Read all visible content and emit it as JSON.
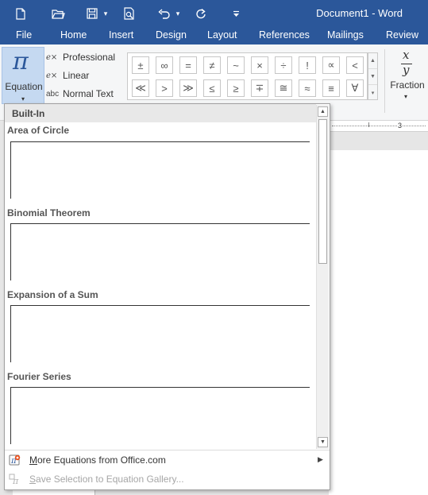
{
  "window": {
    "title": "Document1 - Word"
  },
  "quick_access": {
    "icons": [
      "new-document-icon",
      "open-folder-icon",
      "save-icon",
      "save-dropdown-icon",
      "print-preview-icon",
      "undo-icon",
      "undo-dropdown-icon",
      "redo-icon",
      "customize-toolbar-icon"
    ]
  },
  "tabs": [
    "File",
    "Home",
    "Insert",
    "Design",
    "Layout",
    "References",
    "Mailings",
    "Review"
  ],
  "ribbon": {
    "equation_label": "Equation",
    "equation_symbol": "π",
    "caret": "▾",
    "tools": {
      "professional": "Professional",
      "linear": "Linear",
      "normal_text": "Normal Text",
      "abc_icon": "abc",
      "ex_icon": "e×"
    },
    "symbols_row1": [
      "±",
      "∞",
      "=",
      "≠",
      "~",
      "×",
      "÷",
      "!",
      "∝",
      "<"
    ],
    "symbols_row2": [
      "≪",
      ">",
      "≫",
      "≤",
      "≥",
      "∓",
      "≅",
      "≈",
      "≡",
      "∀"
    ],
    "gallery_scroll": [
      "▲",
      "▼",
      "▾"
    ],
    "fraction": {
      "label": "Fraction",
      "numerator": "x",
      "denominator": "y"
    }
  },
  "ruler": {
    "number": "3"
  },
  "dropdown": {
    "header": "Built-In",
    "sections": [
      "Area of Circle",
      "Binomial Theorem",
      "Expansion of a Sum",
      "Fourier Series"
    ],
    "scroll_up": "▲",
    "scroll_down": "▼",
    "more_equations": {
      "accel": "M",
      "rest": "ore Equations from Office.com",
      "arrow": "▶"
    },
    "save_selection": {
      "accel": "S",
      "rest": "ave Selection to Equation Gallery..."
    }
  },
  "colors": {
    "brand": "#2b579a",
    "selected": "#c5d9f1",
    "disabled_text": "#a6a6a6"
  }
}
